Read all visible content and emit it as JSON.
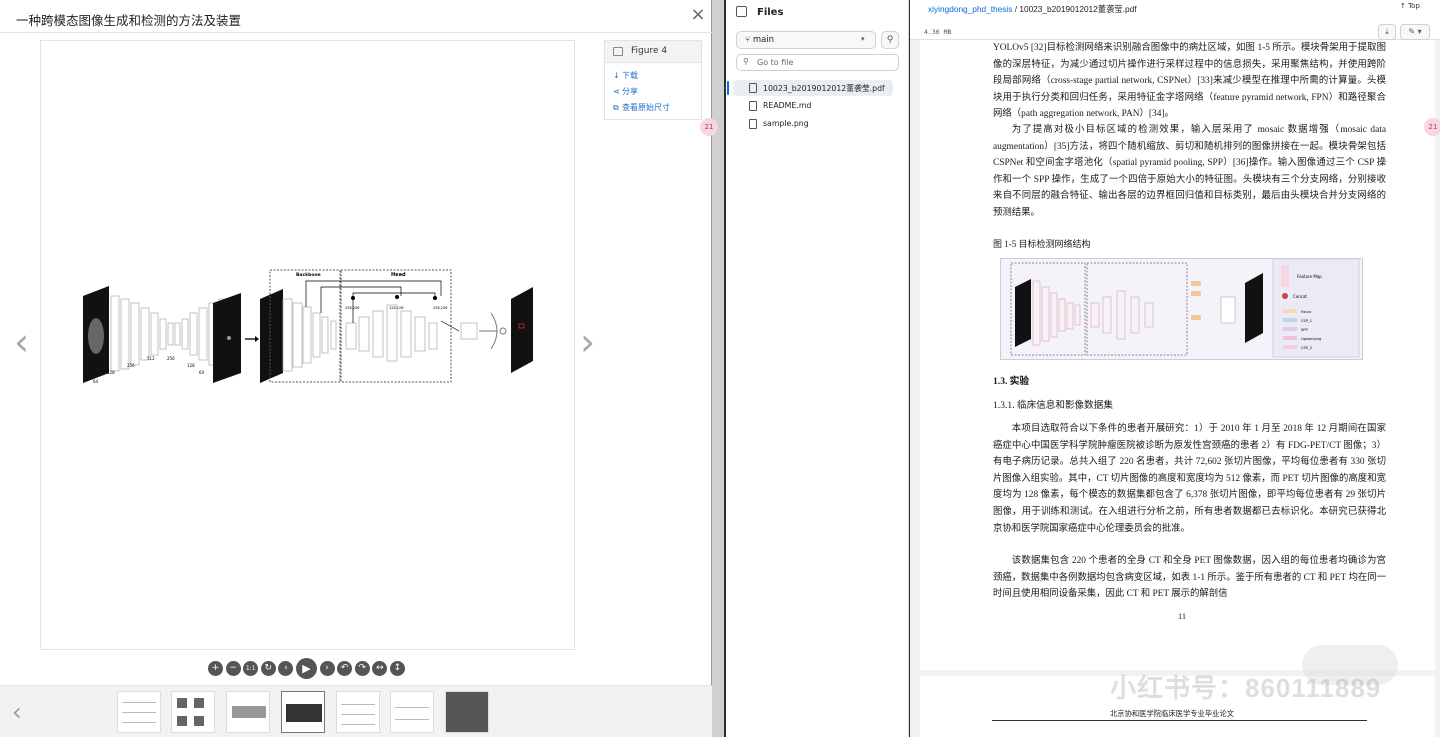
{
  "viewer": {
    "title": "一种跨模态图像生成和检测的方法及装置",
    "close": "×",
    "nav_prev": "‹",
    "nav_next": "›",
    "panel": {
      "figure_label": "Figure 4",
      "download": "下载",
      "share": "分享",
      "original_size": "查看原始尺寸"
    },
    "diagram": {
      "backbone": "Backbone",
      "head": "Head",
      "labels_left": [
        "64",
        "128",
        "256",
        "512",
        "256",
        "128",
        "64"
      ],
      "labels_right": [
        "64",
        "128",
        "256",
        "512",
        "256",
        "128",
        "512"
      ],
      "head_labels": [
        "256,256",
        "128,128",
        "256,256"
      ]
    },
    "toolbar": [
      "+",
      "−",
      "1:1",
      "↻",
      "‹",
      "▶",
      "›",
      "↶",
      "↷",
      "↔",
      "↕"
    ],
    "thumb_prev": "‹"
  },
  "files": {
    "title": "Files",
    "branch": "main",
    "goto_placeholder": "Go to file",
    "items": [
      {
        "name": "10023_b2019012012董袭莹.pdf",
        "selected": true
      },
      {
        "name": "README.md",
        "selected": false
      },
      {
        "name": "sample.png",
        "selected": false
      }
    ]
  },
  "pdf": {
    "repo": "xiyingdong_phd_thesis",
    "separator": " / ",
    "file": "10023_b2019012012董袭莹.pdf",
    "top": "Top",
    "size": "4.36 MB",
    "para1": "YOLOv5 [32]目标检测网络来识别融合图像中的病灶区域，如图 1-5 所示。模块骨架用于提取图像的深层特征，为减少通过切片操作进行采样过程中的信息损失，采用聚焦结构，并使用跨阶段局部网络（cross-stage partial network, CSPNet）[33]来减少模型在推理中所需的计算量。头模块用于执行分类和回归任务，采用特征金字塔网络（feature pyramid network, FPN）和路径聚合网络（path aggregation network, PAN）[34]。",
    "para2": "为了提高对极小目标区域的检测效果，输入层采用了 mosaic 数据增强（mosaic data augmentation）[35]方法，将四个随机缩放、剪切和随机排列的图像拼接在一起。模块骨架包括 CSPNet 和空间金字塔池化（spatial pyramid pooling, SPP）[36]操作。输入图像通过三个 CSP 操作和一个 SPP 操作，生成了一个四倍于原始大小的特征图。头模块有三个分支网络，分别接收来自不同层的融合特征、输出各层的边界框回归值和目标类别，最后由头模块合并分支网络的预测结果。",
    "fig_caption": "图 1-5 目标检测网络结构",
    "legend": [
      "Feature Map",
      "Concat",
      "Focus",
      "CSP_1",
      "SPP",
      "Upsamping",
      "CSP_2"
    ],
    "sec1": "1.3. 实验",
    "sec2": "1.3.1. 临床信息和影像数据集",
    "para3": "本项目选取符合以下条件的患者开展研究：1）于 2010 年 1 月至 2018 年 12 月期间在国家癌症中心中国医学科学院肿瘤医院被诊断为原发性宫颈癌的患者 2）有 FDG-PET/CT 图像；3）有电子病历记录。总共入组了 220 名患者，共计 72,602 张切片图像，平均每位患者有 330 张切片图像入组实验。其中，CT 切片图像的高度和宽度均为 512 像素，而 PET 切片图像的高度和宽度均为 128 像素，每个模态的数据集都包含了 6,378 张切片图像，即平均每位患者有 29 张切片图像，用于训练和测试。在入组进行分析之前，所有患者数据都已去标识化。本研究已获得北京协和医学院国家癌症中心伦理委员会的批准。",
    "para4": "该数据集包含 220 个患者的全身 CT 和全身 PET 图像数据，因入组的每位患者均确诊为宫颈癌，数据集中各例数据均包含病变区域，如表 1-1 所示。鉴于所有患者的 CT 和 PET 均在同一时间且使用相同设备采集，因此 CT 和 PET 展示的解剖信",
    "page_no": "11",
    "footer": "北京协和医学院临床医学专业毕业论文",
    "watermark": "小红书号：860111889"
  }
}
